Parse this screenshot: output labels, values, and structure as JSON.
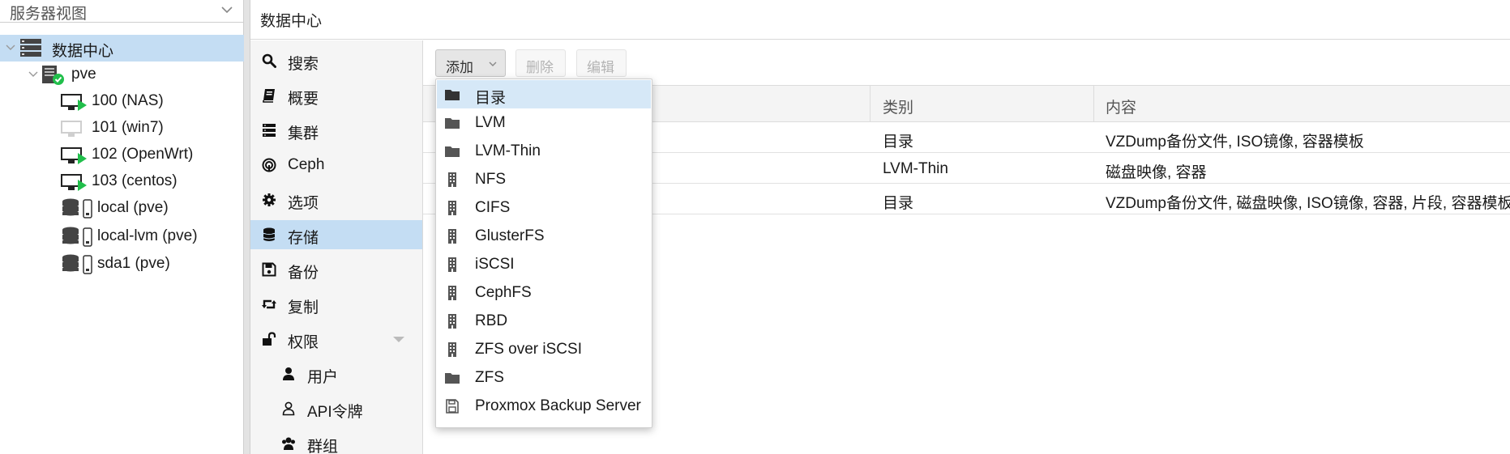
{
  "view_selector": {
    "label": "服务器视图"
  },
  "tree": {
    "datacenter": "数据中心",
    "node": "pve",
    "vms": [
      {
        "label": "100 (NAS)",
        "status": "running"
      },
      {
        "label": "101 (win7)",
        "status": "stopped"
      },
      {
        "label": "102 (OpenWrt)",
        "status": "running"
      },
      {
        "label": "103 (centos)",
        "status": "running"
      }
    ],
    "storages": [
      {
        "label": "local (pve)"
      },
      {
        "label": "local-lvm (pve)"
      },
      {
        "label": "sda1 (pve)"
      }
    ]
  },
  "header": {
    "title": "数据中心"
  },
  "nav": [
    {
      "label": "搜索",
      "icon": "search-icon"
    },
    {
      "label": "概要",
      "icon": "book-icon"
    },
    {
      "label": "集群",
      "icon": "server-stack-icon"
    },
    {
      "label": "Ceph",
      "icon": "ceph-icon"
    },
    {
      "label": "选项",
      "icon": "gear-icon"
    },
    {
      "label": "存储",
      "icon": "database-icon"
    },
    {
      "label": "备份",
      "icon": "floppy-icon"
    },
    {
      "label": "复制",
      "icon": "retweet-icon"
    },
    {
      "label": "权限",
      "icon": "unlock-icon"
    },
    {
      "label": "用户",
      "icon": "user-icon"
    },
    {
      "label": "API令牌",
      "icon": "user-outline-icon"
    },
    {
      "label": "群组",
      "icon": "users-icon"
    }
  ],
  "toolbar": {
    "add": "添加",
    "remove": "删除",
    "edit": "编辑"
  },
  "grid": {
    "columns": [
      "类别",
      "内容"
    ],
    "rows": [
      {
        "type": "目录",
        "content": "VZDump备份文件, ISO镜像, 容器模板"
      },
      {
        "type": "LVM-Thin",
        "content": "磁盘映像, 容器"
      },
      {
        "type": "目录",
        "content": "VZDump备份文件, 磁盘映像, ISO镜像, 容器, 片段, 容器模板"
      }
    ]
  },
  "menu": [
    {
      "label": "目录",
      "icon": "folder-icon"
    },
    {
      "label": "LVM",
      "icon": "folder-icon"
    },
    {
      "label": "LVM-Thin",
      "icon": "folder-icon"
    },
    {
      "label": "NFS",
      "icon": "building-icon"
    },
    {
      "label": "CIFS",
      "icon": "building-icon"
    },
    {
      "label": "GlusterFS",
      "icon": "building-icon"
    },
    {
      "label": "iSCSI",
      "icon": "building-icon"
    },
    {
      "label": "CephFS",
      "icon": "building-icon"
    },
    {
      "label": "RBD",
      "icon": "building-icon"
    },
    {
      "label": "ZFS over iSCSI",
      "icon": "building-icon"
    },
    {
      "label": "ZFS",
      "icon": "folder-icon"
    },
    {
      "label": "Proxmox Backup Server",
      "icon": "floppy-outline-icon"
    }
  ],
  "colors": {
    "selection": "#c4ddf3",
    "menu_highlight": "#d6e8f7",
    "running": "#21bf4b"
  }
}
